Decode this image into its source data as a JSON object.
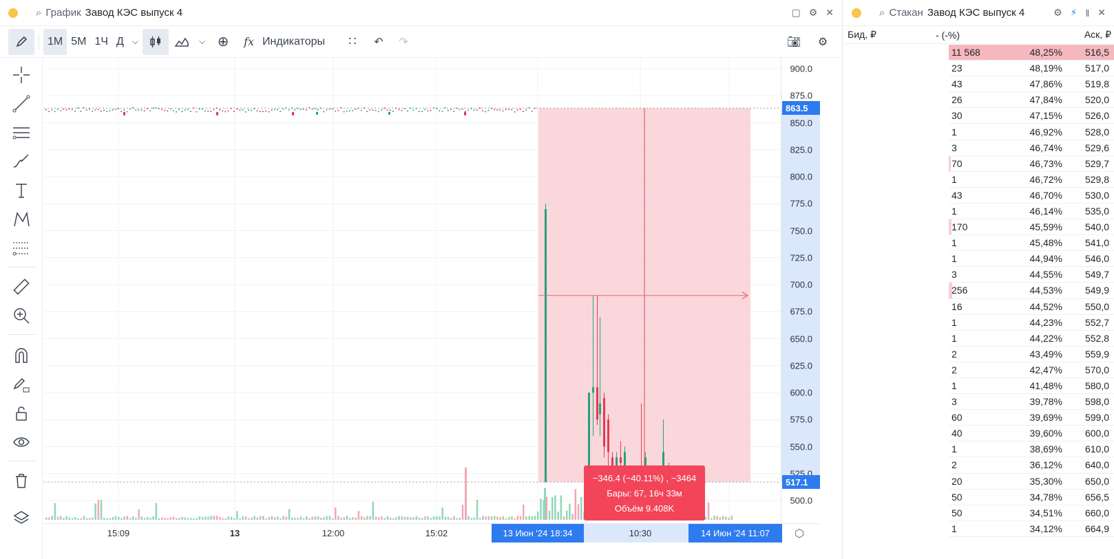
{
  "chart_panel": {
    "title_label": "График",
    "title_name": "Завод КЭС выпуск 4",
    "toolbar": {
      "timeframes": [
        "1М",
        "5М",
        "1Ч",
        "Д"
      ],
      "indicators_label": "Индикаторы"
    },
    "price_axis": {
      "ticks": [
        "900.0",
        "875.0",
        "850.0",
        "825.0",
        "800.0",
        "775.0",
        "750.0",
        "725.0",
        "700.0",
        "675.0",
        "650.0",
        "625.0",
        "600.0",
        "575.0",
        "550.0",
        "525.0",
        "500.0"
      ],
      "last_price": "863.5",
      "cursor_price": "517.1"
    },
    "time_axis": {
      "labels": [
        "15:09",
        "13",
        "12:00",
        "15:02",
        "10:30"
      ],
      "range_start": "13 Июн '24   18:34",
      "range_end": "14 Июн '24   11:07"
    },
    "measure_tooltip": {
      "line1": "−346.4 (−40.11%) , −3464",
      "line2": "Бары: 67, 16ч 33м",
      "line3": "Объём 9.408K"
    },
    "colors": {
      "up": "#26a17b",
      "down": "#e53950",
      "accent": "#2e7bf0",
      "range_fill": "#f8c9cf"
    },
    "chart_data": {
      "type": "candlestick",
      "price_range": [
        490,
        910
      ],
      "flat_level": 863.5,
      "measure": {
        "from": 863.5,
        "to": 517.1,
        "change": -346.4,
        "change_pct": -40.11,
        "bars": 67,
        "duration": "16ч 33м",
        "volume": "9.408K"
      },
      "late_candles": [
        {
          "o": 517,
          "h": 775,
          "l": 517,
          "c": 770
        },
        {
          "o": 517,
          "h": 600,
          "l": 517,
          "c": 600
        },
        {
          "o": 600,
          "h": 690,
          "l": 560,
          "c": 605
        },
        {
          "o": 605,
          "h": 690,
          "l": 570,
          "c": 575
        },
        {
          "o": 580,
          "h": 670,
          "l": 560,
          "c": 590
        },
        {
          "o": 595,
          "h": 600,
          "l": 540,
          "c": 550
        },
        {
          "o": 575,
          "h": 580,
          "l": 530,
          "c": 545
        },
        {
          "o": 540,
          "h": 545,
          "l": 520,
          "c": 525
        },
        {
          "o": 520,
          "h": 545,
          "l": 518,
          "c": 540
        },
        {
          "o": 540,
          "h": 555,
          "l": 520,
          "c": 535
        },
        {
          "o": 530,
          "h": 550,
          "l": 520,
          "c": 545
        },
        {
          "o": 530,
          "h": 590,
          "l": 520,
          "c": 525
        },
        {
          "o": 525,
          "h": 545,
          "l": 518,
          "c": 540
        },
        {
          "o": 520,
          "h": 575,
          "l": 518,
          "c": 545
        },
        {
          "o": 525,
          "h": 535,
          "l": 518,
          "c": 530
        }
      ]
    }
  },
  "book_panel": {
    "title_label": "Стакан",
    "title_name": "Завод КЭС выпуск 4",
    "headers": {
      "bid": "Бид, ₽",
      "pct": "- (-%)",
      "ask": "Аск, ₽"
    },
    "rows": [
      {
        "qty": "11 568",
        "pct": "48,25%",
        "price": "516,5",
        "level": 1.0
      },
      {
        "qty": "23",
        "pct": "48,19%",
        "price": "517,0",
        "level": 0.0
      },
      {
        "qty": "43",
        "pct": "47,86%",
        "price": "519,8",
        "level": 0.0
      },
      {
        "qty": "26",
        "pct": "47,84%",
        "price": "520,0",
        "level": 0.0
      },
      {
        "qty": "30",
        "pct": "47,15%",
        "price": "526,0",
        "level": 0.0
      },
      {
        "qty": "1",
        "pct": "46,92%",
        "price": "528,0",
        "level": 0.0
      },
      {
        "qty": "3",
        "pct": "46,74%",
        "price": "529,6",
        "level": 0.0
      },
      {
        "qty": "70",
        "pct": "46,73%",
        "price": "529,7",
        "level": 0.01
      },
      {
        "qty": "1",
        "pct": "46,72%",
        "price": "529,8",
        "level": 0.0
      },
      {
        "qty": "43",
        "pct": "46,70%",
        "price": "530,0",
        "level": 0.0
      },
      {
        "qty": "1",
        "pct": "46,14%",
        "price": "535,0",
        "level": 0.0
      },
      {
        "qty": "170",
        "pct": "45,59%",
        "price": "540,0",
        "level": 0.015
      },
      {
        "qty": "1",
        "pct": "45,48%",
        "price": "541,0",
        "level": 0.0
      },
      {
        "qty": "1",
        "pct": "44,94%",
        "price": "546,0",
        "level": 0.0
      },
      {
        "qty": "3",
        "pct": "44,55%",
        "price": "549,7",
        "level": 0.0
      },
      {
        "qty": "256",
        "pct": "44,53%",
        "price": "549,9",
        "level": 0.02
      },
      {
        "qty": "16",
        "pct": "44,52%",
        "price": "550,0",
        "level": 0.0
      },
      {
        "qty": "1",
        "pct": "44,23%",
        "price": "552,7",
        "level": 0.0
      },
      {
        "qty": "1",
        "pct": "44,22%",
        "price": "552,8",
        "level": 0.0
      },
      {
        "qty": "2",
        "pct": "43,49%",
        "price": "559,9",
        "level": 0.0
      },
      {
        "qty": "2",
        "pct": "42,47%",
        "price": "570,0",
        "level": 0.0
      },
      {
        "qty": "1",
        "pct": "41,48%",
        "price": "580,0",
        "level": 0.0
      },
      {
        "qty": "3",
        "pct": "39,78%",
        "price": "598,0",
        "level": 0.0
      },
      {
        "qty": "60",
        "pct": "39,69%",
        "price": "599,0",
        "level": 0.0
      },
      {
        "qty": "40",
        "pct": "39,60%",
        "price": "600,0",
        "level": 0.0
      },
      {
        "qty": "1",
        "pct": "38,69%",
        "price": "610,0",
        "level": 0.0
      },
      {
        "qty": "2",
        "pct": "36,12%",
        "price": "640,0",
        "level": 0.0
      },
      {
        "qty": "20",
        "pct": "35,30%",
        "price": "650,0",
        "level": 0.0
      },
      {
        "qty": "50",
        "pct": "34,78%",
        "price": "656,5",
        "level": 0.0
      },
      {
        "qty": "50",
        "pct": "34,51%",
        "price": "660,0",
        "level": 0.0
      },
      {
        "qty": "1",
        "pct": "34,12%",
        "price": "664,9",
        "level": 0.0
      }
    ]
  }
}
